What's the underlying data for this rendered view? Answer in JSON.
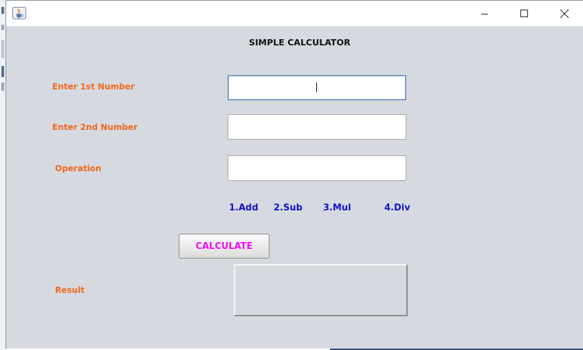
{
  "window": {
    "title": "",
    "app_icon": "java-cup-icon",
    "controls": {
      "minimize_icon": "minimize-icon",
      "maximize_icon": "maximize-icon",
      "close_icon": "close-icon"
    }
  },
  "calculator": {
    "heading": "SIMPLE CALCULATOR",
    "first_number": {
      "label": "Enter 1st Number",
      "value": "",
      "focused": true
    },
    "second_number": {
      "label": "Enter 2nd Number",
      "value": ""
    },
    "operation": {
      "label": "Operation",
      "value": "",
      "options": [
        "1.Add",
        "2.Sub",
        "3.Mul",
        "4.Div"
      ]
    },
    "calculate_button": "CALCULATE",
    "result": {
      "label": "Result",
      "value": ""
    }
  },
  "colors": {
    "background": "#d6d9e0",
    "label": "#ef6a1e",
    "option": "#1414c8",
    "button_text": "#f00cf0",
    "focus_border": "#7c9cbf"
  }
}
